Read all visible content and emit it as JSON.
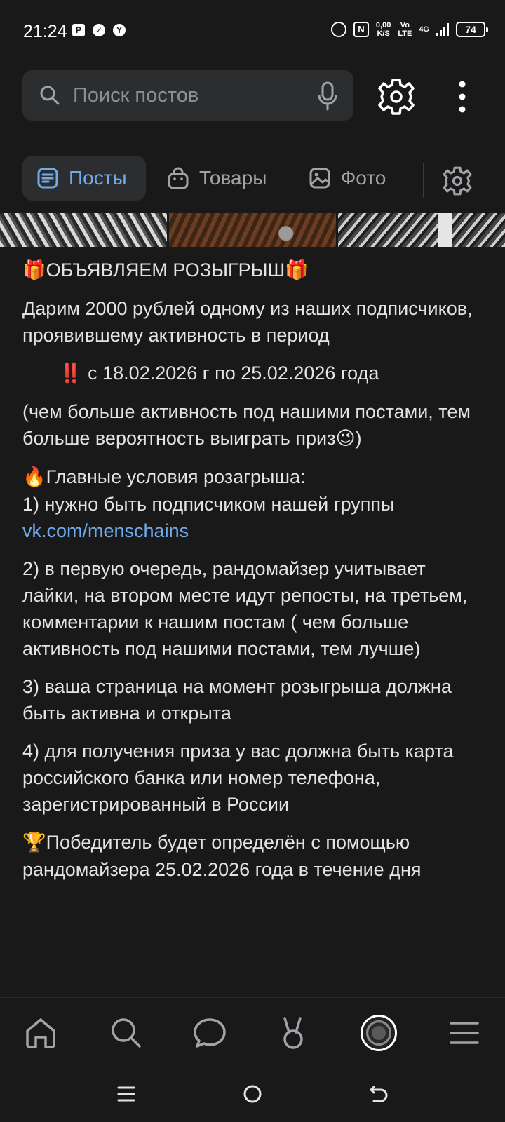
{
  "status_bar": {
    "time": "21:24",
    "left_icons": [
      "P",
      "✓",
      "Y"
    ],
    "net_speed_value": "0,00",
    "net_speed_unit": "K/S",
    "network_top": "Vo",
    "network_bottom": "LTE",
    "network_type": "4G",
    "battery": "74"
  },
  "search": {
    "placeholder": "Поиск постов",
    "value": ""
  },
  "tabs": [
    {
      "label": "Посты",
      "icon": "list-icon",
      "active": true
    },
    {
      "label": "Товары",
      "icon": "bag-icon",
      "active": false
    },
    {
      "label": "Фото",
      "icon": "image-icon",
      "active": false
    }
  ],
  "post": {
    "title": "ОБЪЯВЛЯЕМ РОЗЫГРЫШ",
    "p1": "Дарим 2000 рублей одному из наших подписчиков, проявившему активность в период",
    "p2": "с 18.02.2026 г по 25.02.2026 года",
    "p3": "(чем больше активность под нашими постами, тем больше вероятность выиграть приз",
    "p3_end": ")",
    "conditions_title": "Главные условия розагрыша:",
    "cond1": "1) нужно быть подписчиком нашей группы",
    "cond1_link": "vk.com/menschains",
    "cond2": "2) в первую очередь, рандомайзер учитывает лайки, на втором месте идут репосты, на третьем, комментарии к  нашим постам ( чем больше активность под нашими постами, тем лучше)",
    "cond3": "3) ваша страница на момент розыгрыша должна быть активна и открыта",
    "cond4": "4) для получения приза у вас должна быть карта российского банка или номер телефона, зарегистрированный в России",
    "winner": "Победитель будет определён с помощью рандомайзера 25.02.2026 года в течение дня"
  },
  "emoji": {
    "gift": "🎁",
    "double_exclamation": "‼️",
    "wink": "😉",
    "fire": "🔥",
    "trophy": "🏆"
  },
  "bottom_nav": [
    "home-icon",
    "search-icon",
    "messages-icon",
    "clips-icon",
    "avatar",
    "menu-icon"
  ],
  "colors": {
    "background": "#19191a",
    "surface": "#2c2d2e",
    "accent": "#71aaeb",
    "text": "#e1e3e6",
    "secondary": "#a0a3a8"
  }
}
